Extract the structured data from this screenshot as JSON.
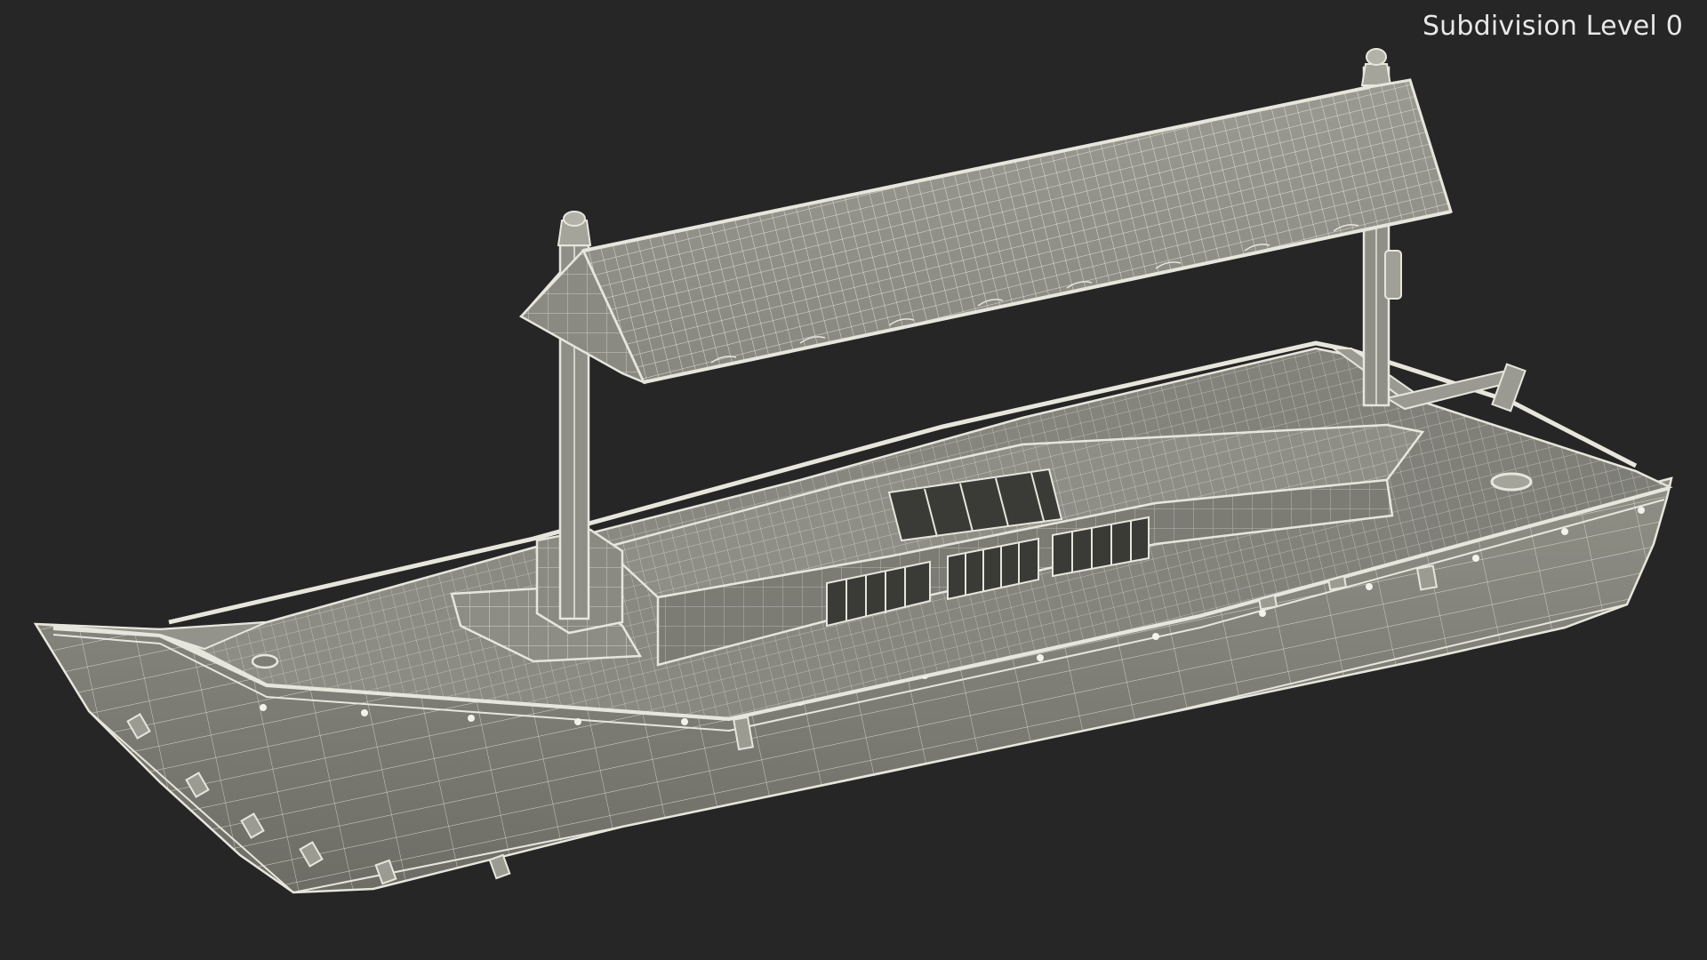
{
  "viewport": {
    "overlay_label": "Subdivision Level 0",
    "background_color": "#262626",
    "model_fill_color": "#8a8a80",
    "wire_color": "#e6e6dc"
  }
}
